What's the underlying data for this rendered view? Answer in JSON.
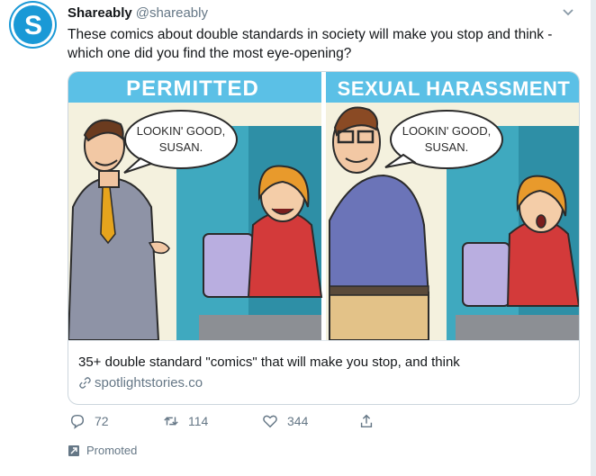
{
  "tweet": {
    "display_name": "Shareably",
    "handle": "@shareably",
    "text": "These comics about double standards in society will make you stop and think - which one did you find the most eye-opening?",
    "avatar_letter": "S",
    "card": {
      "panel_left_label": "PERMITTED",
      "panel_right_label": "SEXUAL HARASSMENT",
      "speech_left": "LOOKIN' GOOD, SUSAN.",
      "speech_right": "LOOKIN' GOOD, SUSAN.",
      "title": "35+ double standard \"comics\" that will make you stop, and think",
      "domain": "spotlightstories.co"
    },
    "actions": {
      "reply_count": "72",
      "retweet_count": "114",
      "like_count": "344"
    },
    "promoted_label": "Promoted"
  },
  "colors": {
    "brand": "#1a99d6",
    "panel_banner": "#5bc0e6",
    "muted_text": "#657786"
  },
  "icons": [
    "shareably-logo",
    "chevron-down-icon",
    "link-icon",
    "reply-icon",
    "retweet-icon",
    "like-icon",
    "share-icon",
    "promoted-icon"
  ]
}
